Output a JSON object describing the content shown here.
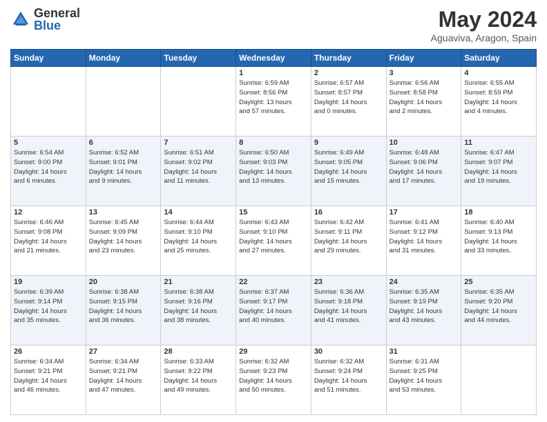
{
  "logo": {
    "general": "General",
    "blue": "Blue"
  },
  "title": "May 2024",
  "subtitle": "Aguaviva, Aragon, Spain",
  "weekdays": [
    "Sunday",
    "Monday",
    "Tuesday",
    "Wednesday",
    "Thursday",
    "Friday",
    "Saturday"
  ],
  "weeks": [
    [
      {
        "num": "",
        "info": ""
      },
      {
        "num": "",
        "info": ""
      },
      {
        "num": "",
        "info": ""
      },
      {
        "num": "1",
        "info": "Sunrise: 6:59 AM\nSunset: 8:56 PM\nDaylight: 13 hours\nand 57 minutes."
      },
      {
        "num": "2",
        "info": "Sunrise: 6:57 AM\nSunset: 8:57 PM\nDaylight: 14 hours\nand 0 minutes."
      },
      {
        "num": "3",
        "info": "Sunrise: 6:56 AM\nSunset: 8:58 PM\nDaylight: 14 hours\nand 2 minutes."
      },
      {
        "num": "4",
        "info": "Sunrise: 6:55 AM\nSunset: 8:59 PM\nDaylight: 14 hours\nand 4 minutes."
      }
    ],
    [
      {
        "num": "5",
        "info": "Sunrise: 6:54 AM\nSunset: 9:00 PM\nDaylight: 14 hours\nand 6 minutes."
      },
      {
        "num": "6",
        "info": "Sunrise: 6:52 AM\nSunset: 9:01 PM\nDaylight: 14 hours\nand 9 minutes."
      },
      {
        "num": "7",
        "info": "Sunrise: 6:51 AM\nSunset: 9:02 PM\nDaylight: 14 hours\nand 11 minutes."
      },
      {
        "num": "8",
        "info": "Sunrise: 6:50 AM\nSunset: 9:03 PM\nDaylight: 14 hours\nand 13 minutes."
      },
      {
        "num": "9",
        "info": "Sunrise: 6:49 AM\nSunset: 9:05 PM\nDaylight: 14 hours\nand 15 minutes."
      },
      {
        "num": "10",
        "info": "Sunrise: 6:48 AM\nSunset: 9:06 PM\nDaylight: 14 hours\nand 17 minutes."
      },
      {
        "num": "11",
        "info": "Sunrise: 6:47 AM\nSunset: 9:07 PM\nDaylight: 14 hours\nand 19 minutes."
      }
    ],
    [
      {
        "num": "12",
        "info": "Sunrise: 6:46 AM\nSunset: 9:08 PM\nDaylight: 14 hours\nand 21 minutes."
      },
      {
        "num": "13",
        "info": "Sunrise: 6:45 AM\nSunset: 9:09 PM\nDaylight: 14 hours\nand 23 minutes."
      },
      {
        "num": "14",
        "info": "Sunrise: 6:44 AM\nSunset: 9:10 PM\nDaylight: 14 hours\nand 25 minutes."
      },
      {
        "num": "15",
        "info": "Sunrise: 6:43 AM\nSunset: 9:10 PM\nDaylight: 14 hours\nand 27 minutes."
      },
      {
        "num": "16",
        "info": "Sunrise: 6:42 AM\nSunset: 9:11 PM\nDaylight: 14 hours\nand 29 minutes."
      },
      {
        "num": "17",
        "info": "Sunrise: 6:41 AM\nSunset: 9:12 PM\nDaylight: 14 hours\nand 31 minutes."
      },
      {
        "num": "18",
        "info": "Sunrise: 6:40 AM\nSunset: 9:13 PM\nDaylight: 14 hours\nand 33 minutes."
      }
    ],
    [
      {
        "num": "19",
        "info": "Sunrise: 6:39 AM\nSunset: 9:14 PM\nDaylight: 14 hours\nand 35 minutes."
      },
      {
        "num": "20",
        "info": "Sunrise: 6:38 AM\nSunset: 9:15 PM\nDaylight: 14 hours\nand 36 minutes."
      },
      {
        "num": "21",
        "info": "Sunrise: 6:38 AM\nSunset: 9:16 PM\nDaylight: 14 hours\nand 38 minutes."
      },
      {
        "num": "22",
        "info": "Sunrise: 6:37 AM\nSunset: 9:17 PM\nDaylight: 14 hours\nand 40 minutes."
      },
      {
        "num": "23",
        "info": "Sunrise: 6:36 AM\nSunset: 9:18 PM\nDaylight: 14 hours\nand 41 minutes."
      },
      {
        "num": "24",
        "info": "Sunrise: 6:35 AM\nSunset: 9:19 PM\nDaylight: 14 hours\nand 43 minutes."
      },
      {
        "num": "25",
        "info": "Sunrise: 6:35 AM\nSunset: 9:20 PM\nDaylight: 14 hours\nand 44 minutes."
      }
    ],
    [
      {
        "num": "26",
        "info": "Sunrise: 6:34 AM\nSunset: 9:21 PM\nDaylight: 14 hours\nand 46 minutes."
      },
      {
        "num": "27",
        "info": "Sunrise: 6:34 AM\nSunset: 9:21 PM\nDaylight: 14 hours\nand 47 minutes."
      },
      {
        "num": "28",
        "info": "Sunrise: 6:33 AM\nSunset: 9:22 PM\nDaylight: 14 hours\nand 49 minutes."
      },
      {
        "num": "29",
        "info": "Sunrise: 6:32 AM\nSunset: 9:23 PM\nDaylight: 14 hours\nand 50 minutes."
      },
      {
        "num": "30",
        "info": "Sunrise: 6:32 AM\nSunset: 9:24 PM\nDaylight: 14 hours\nand 51 minutes."
      },
      {
        "num": "31",
        "info": "Sunrise: 6:31 AM\nSunset: 9:25 PM\nDaylight: 14 hours\nand 53 minutes."
      },
      {
        "num": "",
        "info": ""
      }
    ]
  ]
}
